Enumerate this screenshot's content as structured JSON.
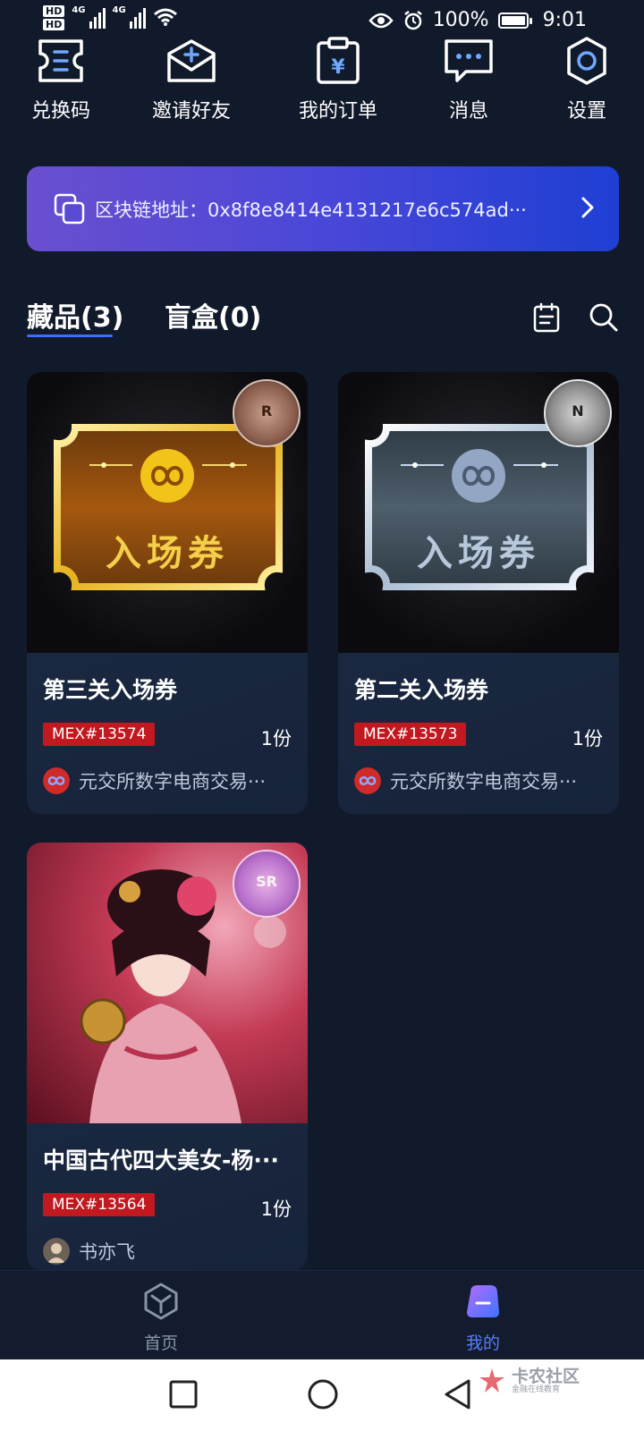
{
  "status_bar": {
    "hd1": "HD",
    "hd2": "HD",
    "net1": "4G",
    "net2": "4G",
    "battery": "100%",
    "time": "9:01"
  },
  "quick_actions": [
    {
      "label": "兑换码",
      "icon": "ticket-icon"
    },
    {
      "label": "邀请好友",
      "icon": "invite-mail-icon"
    },
    {
      "label": "我的订单",
      "icon": "order-clipboard-icon"
    },
    {
      "label": "消息",
      "icon": "message-bubble-icon"
    },
    {
      "label": "设置",
      "icon": "gear-icon"
    }
  ],
  "address": {
    "label": "区块链地址：0x8f8e8414e4131217e6c574ad···"
  },
  "tabs": [
    {
      "label": "藏品(3)",
      "active": true
    },
    {
      "label": "盲盒(0)",
      "active": false
    }
  ],
  "cards": [
    {
      "title": "第三关入场券",
      "serial": "MEX#13574",
      "quantity": "1份",
      "issuer": "元交所数字电商交易···",
      "rarity": "R",
      "ticket_text": "入场券",
      "style": "gold"
    },
    {
      "title": "第二关入场券",
      "serial": "MEX#13573",
      "quantity": "1份",
      "issuer": "元交所数字电商交易···",
      "rarity": "N",
      "ticket_text": "入场券",
      "style": "silver"
    },
    {
      "title": "中国古代四大美女-杨···",
      "serial": "MEX#13564",
      "quantity": "1份",
      "issuer": "书亦飞",
      "rarity": "SR",
      "style": "portrait"
    }
  ],
  "bottom_nav": [
    {
      "label": "首页",
      "icon": "cube-home-icon",
      "active": false
    },
    {
      "label": "我的",
      "icon": "profile-icon",
      "active": true
    }
  ],
  "watermark": {
    "main": "卡农社区",
    "sub": "金融在线教育"
  },
  "colors": {
    "background": "#111a2b",
    "accent": "#3b6ff5",
    "serial_badge": "#c2181f",
    "active_nav": "#5b7cff"
  }
}
